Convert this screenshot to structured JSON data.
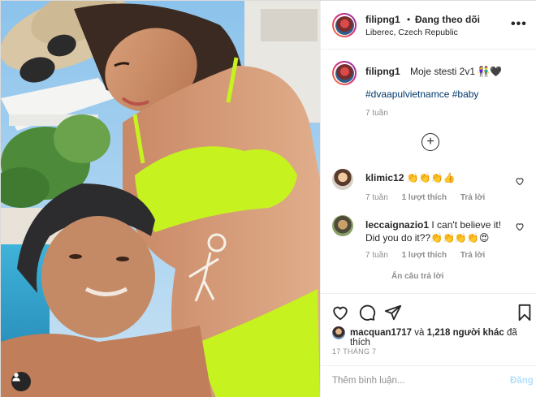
{
  "post": {
    "username": "filipng1",
    "separator": "•",
    "follow_status": "Đang theo dõi",
    "location": "Liberec, Czech Republic",
    "more_label": "•••",
    "caption_text": "Moje stesti 2v1 👫🖤",
    "hashtags": "#dvaapulvietnamce #baby",
    "caption_time": "7 tuần",
    "load_more_label": "+",
    "hide_replies_label": "Ẩn câu trả lời",
    "date": "17 THÁNG 7"
  },
  "comments": [
    {
      "username": "klimic12",
      "text": "👏👏👏👍",
      "time": "7 tuần",
      "likes": "1 lượt thích",
      "reply": "Trả lời"
    },
    {
      "username": "leccaignazio1",
      "text": "I can't believe it! Did you do it??👏👏👏👏😍",
      "time": "7 tuần",
      "likes": "1 lượt thích",
      "reply": "Trả lời"
    }
  ],
  "likes": {
    "user": "macquan1717",
    "rest": " và ",
    "others": "1,218 người khác",
    "suffix": " đã thích"
  },
  "add_comment": {
    "placeholder": "Thêm bình luận...",
    "post_label": "Đăng"
  },
  "colors": {
    "link_blue": "#00376b",
    "muted_gray": "#8e8e8e",
    "post_disabled": "#b2dffc",
    "bikini_neon": "#c6f31f"
  }
}
